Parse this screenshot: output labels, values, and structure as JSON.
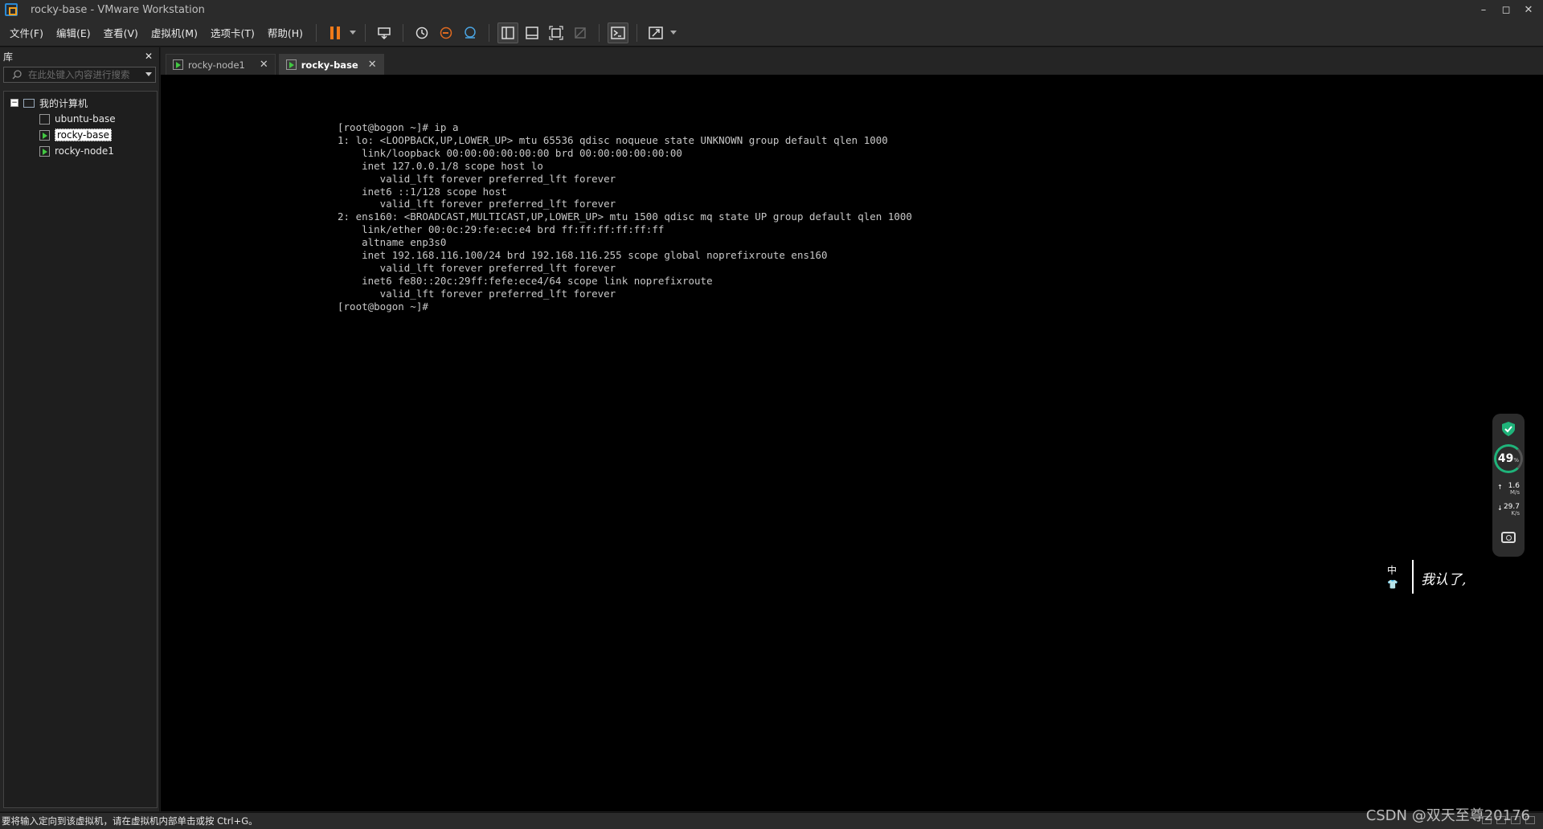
{
  "window": {
    "title": "rocky-base - VMware Workstation",
    "controls": [
      "–",
      "◻",
      "✕"
    ]
  },
  "menu": [
    "文件(F)",
    "编辑(E)",
    "查看(V)",
    "虚拟机(M)",
    "选项卡(T)",
    "帮助(H)"
  ],
  "colors": {
    "pause_accent": "#f07a1a",
    "running_vm": "#42c742",
    "gauge": "#1fb37a",
    "console_bg": "#000000"
  },
  "library": {
    "title": "库",
    "close": "✕",
    "search_placeholder": "在此处键入内容进行搜索",
    "root": "我的计算机",
    "items": [
      {
        "label": "ubuntu-base",
        "running": false,
        "selected": false
      },
      {
        "label": "rocky-base",
        "running": true,
        "selected": true
      },
      {
        "label": "rocky-node1",
        "running": true,
        "selected": false
      }
    ]
  },
  "tabs": [
    {
      "label": "rocky-node1",
      "close": "✕",
      "active": false
    },
    {
      "label": "rocky-base",
      "close": "✕",
      "active": true
    }
  ],
  "console": {
    "text": "[root@bogon ~]# ip a\n1: lo: <LOOPBACK,UP,LOWER_UP> mtu 65536 qdisc noqueue state UNKNOWN group default qlen 1000\n    link/loopback 00:00:00:00:00:00 brd 00:00:00:00:00:00\n    inet 127.0.0.1/8 scope host lo\n       valid_lft forever preferred_lft forever\n    inet6 ::1/128 scope host\n       valid_lft forever preferred_lft forever\n2: ens160: <BROADCAST,MULTICAST,UP,LOWER_UP> mtu 1500 qdisc mq state UP group default qlen 1000\n    link/ether 00:0c:29:fe:ec:e4 brd ff:ff:ff:ff:ff:ff\n    altname enp3s0\n    inet 192.168.116.100/24 brd 192.168.116.255 scope global noprefixroute ens160\n       valid_lft forever preferred_lft forever\n    inet6 fe80::20c:29ff:fefe:ece4/64 scope link noprefixroute\n       valid_lft forever preferred_lft forever\n[root@bogon ~]#"
  },
  "monitor": {
    "usage": "49",
    "usage_unit": "%",
    "upload": "1.6",
    "upload_unit": "M/s",
    "download": "29.7",
    "download_unit": "K/s"
  },
  "ime": {
    "mode": "中",
    "handwriting": "我认了,"
  },
  "status": {
    "message": "要将输入定向到该虚拟机，请在虚拟机内部单击或按 Ctrl+G。"
  },
  "watermark": "CSDN @双天至尊20176"
}
